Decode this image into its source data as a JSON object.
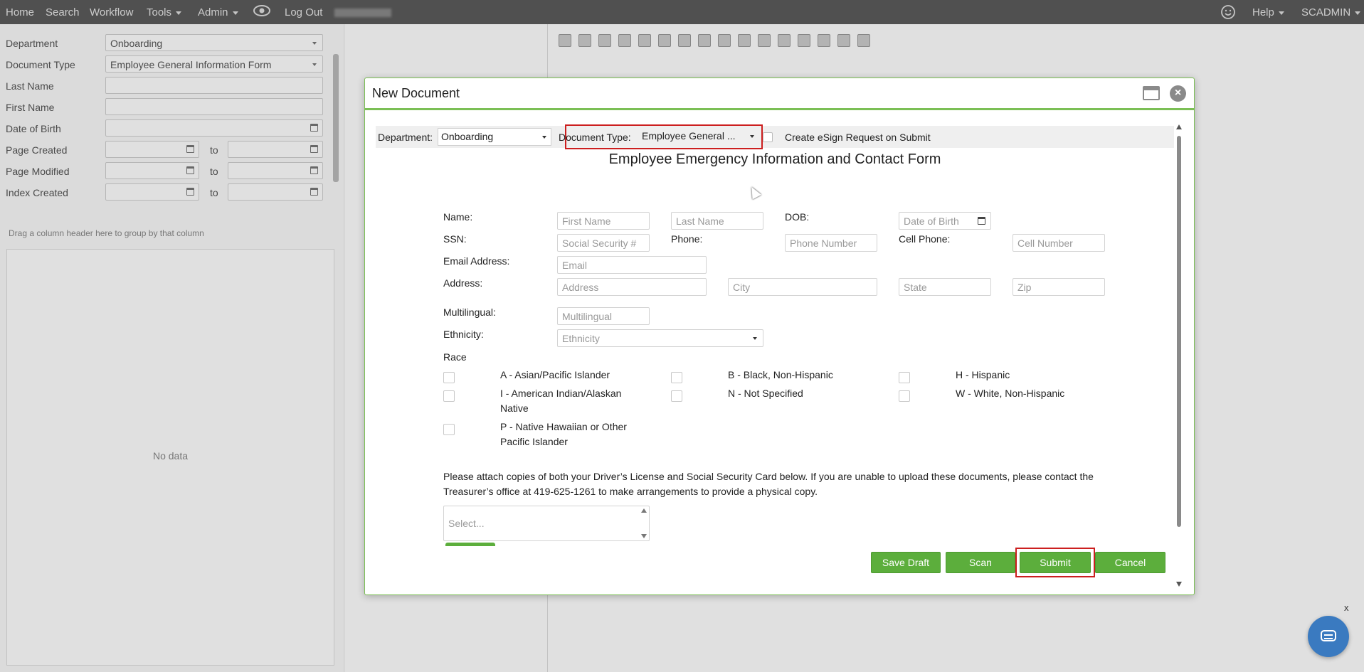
{
  "topnav": {
    "items": [
      "Home",
      "Search",
      "Workflow",
      "Tools",
      "Admin",
      "Log Out"
    ],
    "help": "Help",
    "user": "SCADMIN"
  },
  "search_panel": {
    "fields": [
      {
        "label": "Department",
        "value": "Onboarding"
      },
      {
        "label": "Document Type",
        "value": "Employee General Information Form"
      },
      {
        "label": "Last Name",
        "value": ""
      },
      {
        "label": "First Name",
        "value": ""
      },
      {
        "label": "Date of Birth",
        "value": ""
      },
      {
        "label": "Page Created",
        "to": "to"
      },
      {
        "label": "Page Modified",
        "to": "to"
      },
      {
        "label": "Index Created",
        "to": "to"
      }
    ],
    "group_hint": "Drag a column header here to group by that column",
    "no_data": "No data"
  },
  "modal": {
    "title": "New Document",
    "toolbar": {
      "department_label": "Department:",
      "department_value": "Onboarding",
      "doctype_label": "Document Type:",
      "doctype_value": "Employee General ...",
      "esign_label": "Create eSign Request on Submit"
    },
    "form": {
      "title": "Employee Emergency Information and Contact Form",
      "labels": {
        "name": "Name:",
        "dob": "DOB:",
        "ssn": "SSN:",
        "phone": "Phone:",
        "cell": "Cell Phone:",
        "email": "Email Address:",
        "address": "Address:",
        "multilingual": "Multilingual:",
        "ethnicity": "Ethnicity:",
        "race": "Race"
      },
      "placeholders": {
        "first_name": "First Name",
        "last_name": "Last Name",
        "dob": "Date of Birth",
        "ssn": "Social Security #",
        "phone": "Phone Number",
        "cell": "Cell Number",
        "email": "Email",
        "address": "Address",
        "city": "City",
        "state": "State",
        "zip": "Zip",
        "multilingual": "Multilingual",
        "ethnicity": "Ethnicity",
        "attachments": "Select..."
      },
      "race_options": [
        "A - Asian/Pacific Islander",
        "B - Black, Non-Hispanic",
        "H - Hispanic",
        "I - American Indian/Alaskan Native",
        "N - Not Specified",
        "W - White, Non-Hispanic",
        "P - Native Hawaiian or Other Pacific Islander"
      ],
      "notice": "Please attach copies of both your Driver’s License and Social Security Card below. If you are unable to upload these documents, please contact the Treasurer’s office at 419-625-1261 to make arrangements to provide a physical copy."
    },
    "buttons": {
      "save_draft": "Save Draft",
      "scan": "Scan",
      "submit": "Submit",
      "cancel": "Cancel"
    }
  },
  "chat": {
    "close": "x"
  },
  "colors": {
    "accent": "#5cae3c",
    "highlight": "#cc1f1f",
    "topbar": "#5c5c5c"
  }
}
